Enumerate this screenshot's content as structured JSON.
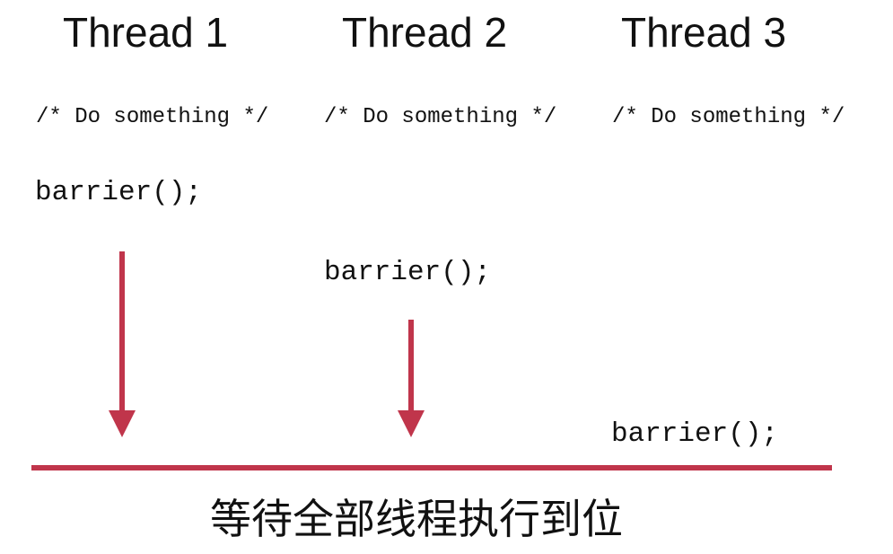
{
  "threads": [
    {
      "title": "Thread 1",
      "comment": "/* Do something */",
      "call": "barrier();"
    },
    {
      "title": "Thread 2",
      "comment": "/* Do something */",
      "call": "barrier();"
    },
    {
      "title": "Thread 3",
      "comment": "/* Do something */",
      "call": "barrier();"
    }
  ],
  "caption": "等待全部线程执行到位",
  "colors": {
    "accent": "#c0354b",
    "text": "#111111",
    "background": "#ffffff"
  }
}
